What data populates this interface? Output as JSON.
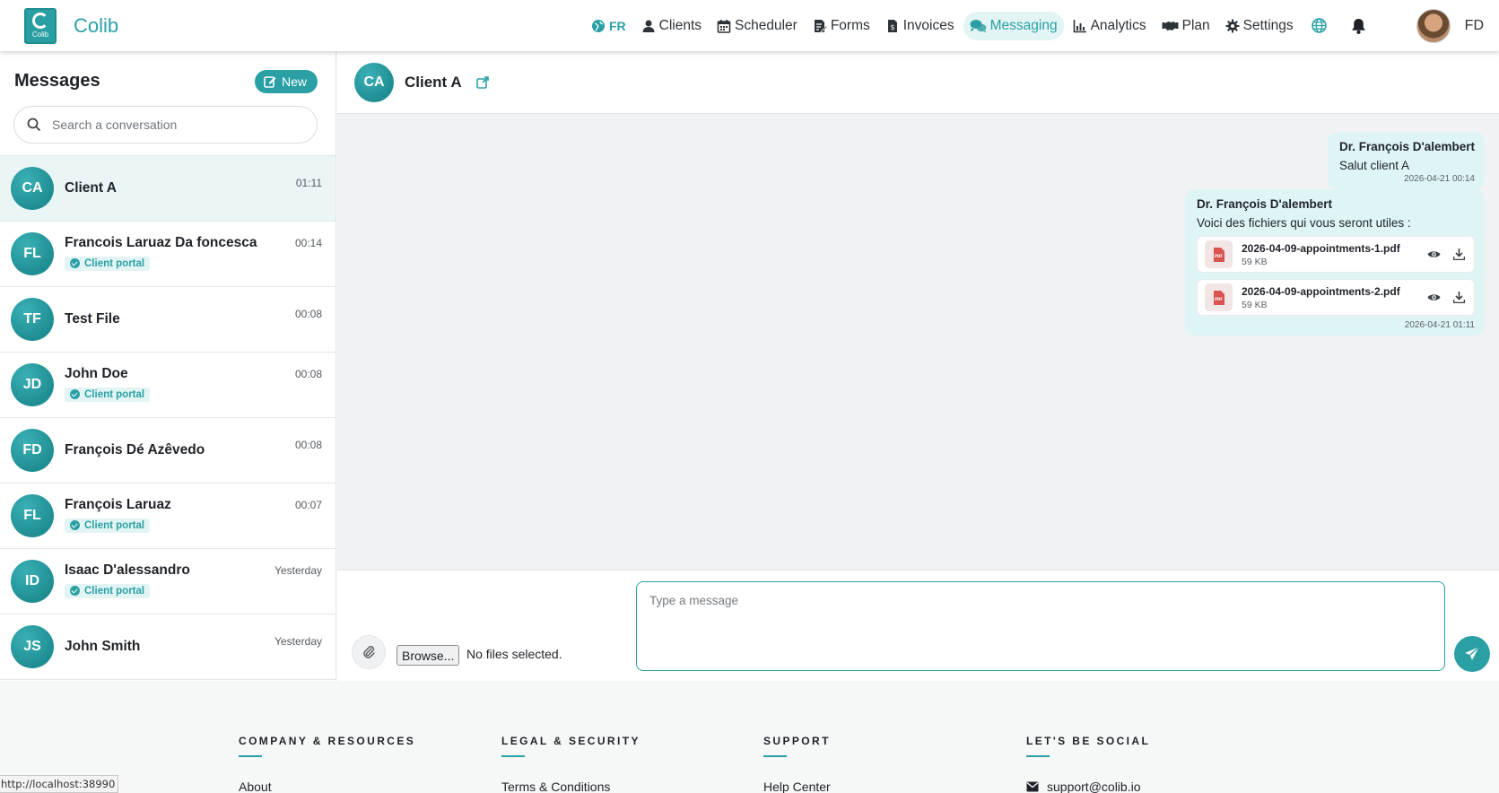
{
  "brand": {
    "name": "Colib",
    "logo_text": "Colib"
  },
  "nav": {
    "lang": "FR",
    "items": [
      {
        "label": "Clients",
        "icon": "user-icon"
      },
      {
        "label": "Scheduler",
        "icon": "calendar-icon"
      },
      {
        "label": "Forms",
        "icon": "form-icon"
      },
      {
        "label": "Invoices",
        "icon": "invoice-icon"
      },
      {
        "label": "Messaging",
        "icon": "chat-icon",
        "active": true
      },
      {
        "label": "Analytics",
        "icon": "chart-icon"
      },
      {
        "label": "Plan",
        "icon": "handshake-icon"
      },
      {
        "label": "Settings",
        "icon": "gear-icon"
      }
    ],
    "user_initials": "FD",
    "accent": "#2aa0a5"
  },
  "sidebar": {
    "title": "Messages",
    "new_label": "New",
    "search_placeholder": "Search a conversation",
    "conversations": [
      {
        "initials": "CA",
        "name": "Client A",
        "time": "01:11",
        "badge": "",
        "selected": true
      },
      {
        "initials": "FL",
        "name": "Francois Laruaz Da foncesca",
        "time": "00:14",
        "badge": "Client portal"
      },
      {
        "initials": "TF",
        "name": "Test File",
        "time": "00:08",
        "badge": ""
      },
      {
        "initials": "JD",
        "name": "John Doe",
        "time": "00:08",
        "badge": "Client portal"
      },
      {
        "initials": "FD",
        "name": "François Dé Azêvedo",
        "time": "00:08",
        "badge": ""
      },
      {
        "initials": "FL",
        "name": "François Laruaz",
        "time": "00:07",
        "badge": "Client portal"
      },
      {
        "initials": "ID",
        "name": "Isaac D'alessandro",
        "time": "Yesterday",
        "badge": "Client portal"
      },
      {
        "initials": "JS",
        "name": "John Smith",
        "time": "Yesterday",
        "badge": ""
      }
    ]
  },
  "chat": {
    "contact_initials": "CA",
    "contact_name": "Client A",
    "messages": [
      {
        "sender": "Dr. François D'alembert",
        "text": "Salut client A",
        "time": "2026-04-21 00:14"
      },
      {
        "sender": "Dr. François D'alembert",
        "text": "Voici des fichiers qui vous seront utiles :",
        "time": "2026-04-21 01:11",
        "files": [
          {
            "name": "2026-04-09-appointments-1.pdf",
            "size": "59 KB"
          },
          {
            "name": "2026-04-09-appointments-2.pdf",
            "size": "59 KB"
          }
        ]
      }
    ],
    "browse_label": "Browse...",
    "no_file_text": "No files selected.",
    "input_placeholder": "Type a message"
  },
  "footer": {
    "columns": [
      {
        "heading": "COMPANY & RESOURCES",
        "link": "About"
      },
      {
        "heading": "LEGAL & SECURITY",
        "link": "Terms & Conditions"
      },
      {
        "heading": "SUPPORT",
        "link": "Help Center"
      },
      {
        "heading": "LET'S BE SOCIAL",
        "link": "support@colib.io",
        "icon": "mail-icon"
      }
    ]
  },
  "status_url": "http://localhost:38990"
}
